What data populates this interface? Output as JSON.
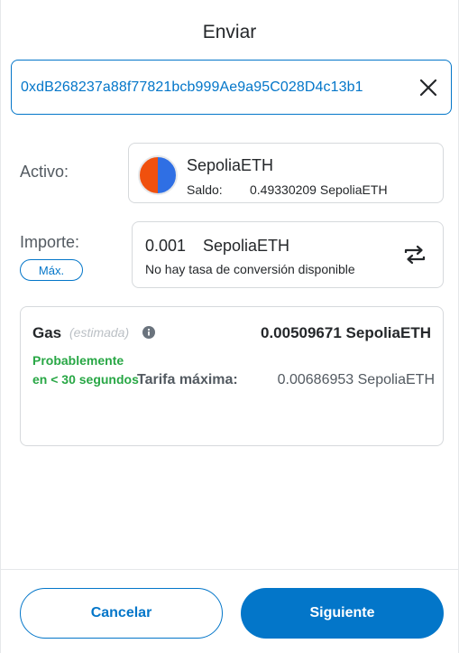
{
  "page": {
    "title": "Enviar"
  },
  "recipient": {
    "address": "0xdB268237a88f77821bcb999Ae9a95C028D4c13b1",
    "clear_icon": "close-icon"
  },
  "asset": {
    "label": "Activo:",
    "name": "SepoliaETH",
    "balance_label": "Saldo:",
    "balance_value": "0.49330209 SepoliaETH",
    "icon": "sepolia-token-icon"
  },
  "amount": {
    "label": "Importe:",
    "max_label": "Máx.",
    "value": "0.001",
    "unit": "SepoliaETH",
    "conversion_text": "No hay tasa de conversión disponible",
    "swap_icon": "swap-arrows-icon"
  },
  "gas": {
    "label": "Gas",
    "estimated_label": "(estimada)",
    "info_icon": "info-icon",
    "value": "0.00509671 SepoliaETH",
    "time_estimate": "Probablemente en < 30 segundos",
    "max_fee_label": "Tarifa máxima:",
    "max_fee_value": "0.00686953 SepoliaETH"
  },
  "footer": {
    "cancel_label": "Cancelar",
    "next_label": "Siguiente"
  },
  "colors": {
    "accent": "#0376c9",
    "success": "#28a745",
    "border": "#d6d9dc",
    "text": "#24272a",
    "muted": "#535a61"
  }
}
